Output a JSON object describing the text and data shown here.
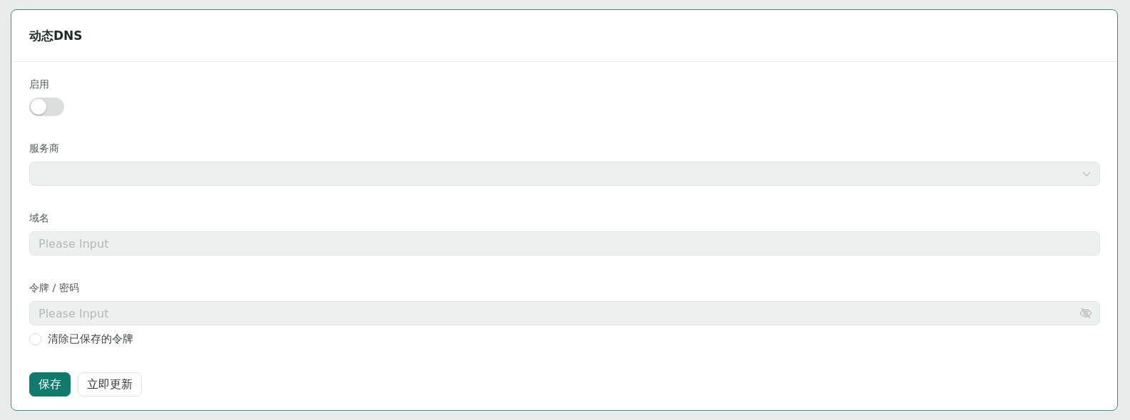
{
  "card": {
    "title": "动态DNS"
  },
  "enable": {
    "label": "启用",
    "on": false
  },
  "provider": {
    "label": "服务商",
    "disabled": true
  },
  "domain": {
    "label": "域名",
    "placeholder": "Please Input",
    "disabled": true
  },
  "token": {
    "label": "令牌 / 密码",
    "placeholder": "Please Input",
    "disabled": true
  },
  "clear_token": {
    "label": "清除已保存的令牌",
    "checked": false
  },
  "buttons": [
    {
      "label": "保存",
      "kind": "primary"
    },
    {
      "label": "立即更新",
      "kind": "default"
    }
  ]
}
